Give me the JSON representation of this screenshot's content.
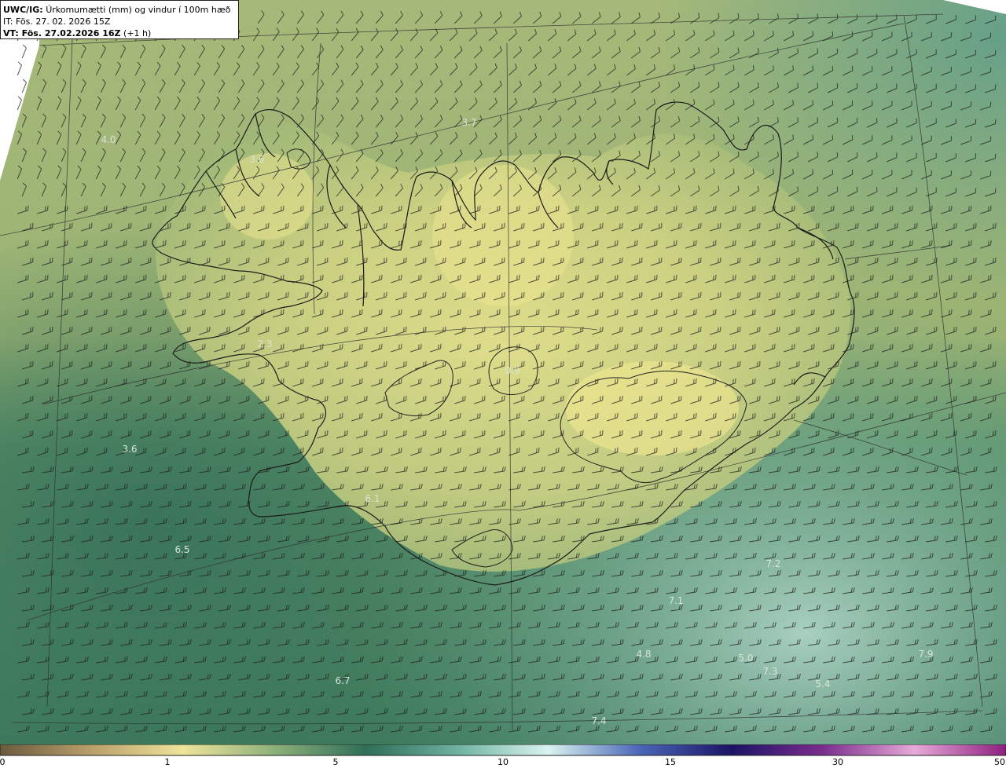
{
  "title": {
    "model": "UWC/IG:",
    "field": "Úrkomumætti (mm) og vindur í 100m hæð",
    "issue_time": "IT: Fös. 27. 02. 2026 15Z",
    "valid_prefix": "VT: Fös. 27.02.2026 16Z",
    "valid_suffix": "(+1 h)"
  },
  "precip_labels": [
    {
      "text": "4.0",
      "ix": 138,
      "iy": 178
    },
    {
      "text": "3.6",
      "ix": 327,
      "iy": 203
    },
    {
      "text": "3.7",
      "ix": 597,
      "iy": 156
    },
    {
      "text": "2.3",
      "ix": 337,
      "iy": 438
    },
    {
      "text": "3.6",
      "ix": 165,
      "iy": 572
    },
    {
      "text": "6.1",
      "ix": 474,
      "iy": 635
    },
    {
      "text": "6.5",
      "ix": 232,
      "iy": 700
    },
    {
      "text": "0.9",
      "ix": 652,
      "iy": 472
    },
    {
      "text": "7.2",
      "ix": 984,
      "iy": 718
    },
    {
      "text": "7.1",
      "ix": 860,
      "iy": 765
    },
    {
      "text": "4.8",
      "ix": 819,
      "iy": 833
    },
    {
      "text": "5.0",
      "ix": 949,
      "iy": 838
    },
    {
      "text": "7.3",
      "ix": 980,
      "iy": 855
    },
    {
      "text": "5.4",
      "ix": 1047,
      "iy": 871
    },
    {
      "text": "7.9",
      "ix": 1178,
      "iy": 833
    },
    {
      "text": "6.7",
      "ix": 436,
      "iy": 867
    },
    {
      "text": "7.4",
      "ix": 762,
      "iy": 918
    }
  ],
  "colorbar": {
    "ticks": [
      "0",
      "1",
      "5",
      "10",
      "15",
      "30",
      "50"
    ],
    "stops": [
      {
        "c": "#6b5a3e"
      },
      {
        "c": "#b9a06a"
      },
      {
        "c": "#eee49a"
      },
      {
        "c": "#8db07a"
      },
      {
        "c": "#2f6e58"
      },
      {
        "c": "#6fb2a0"
      },
      {
        "c": "#d9f4f0"
      },
      {
        "c": "#4a66b8"
      },
      {
        "c": "#1b1464"
      },
      {
        "c": "#7b2d8e"
      },
      {
        "c": "#e6a9d8"
      },
      {
        "c": "#8e1f7e"
      }
    ]
  },
  "colors": {
    "land_high": "#e9e28f",
    "land_mid": "#a7ba76",
    "sea_dark": "#3f7a5c",
    "sea_light": "#7fb9a3",
    "grid_line": "#333333",
    "barb": "#222222",
    "label": "#d8e4d8"
  }
}
